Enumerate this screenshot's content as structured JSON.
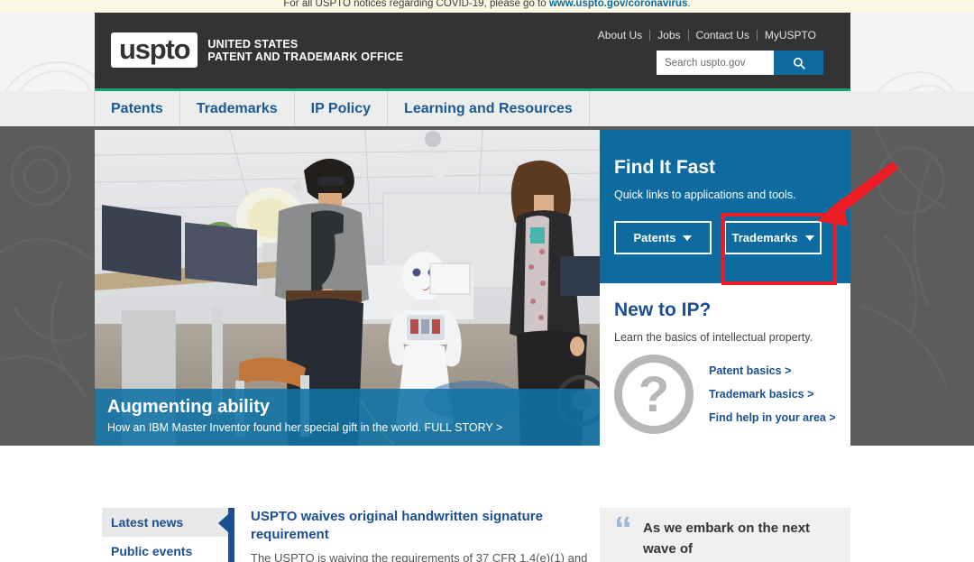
{
  "covid_banner": {
    "text": "For all USPTO notices regarding COVID-19, please go to ",
    "link": "www.uspto.gov/coronavirus",
    "suffix": "."
  },
  "header": {
    "logo_mark": "uspto",
    "logo_line1": "UNITED STATES",
    "logo_line2": "PATENT AND TRADEMARK OFFICE",
    "util_links": [
      "About Us",
      "Jobs",
      "Contact Us",
      "MyUSPTO"
    ],
    "search_placeholder": "Search uspto.gov",
    "search_value": "",
    "search_icon": "search-icon",
    "accent_green": "#1a9e6e",
    "background": "#333333"
  },
  "main_nav": {
    "items": [
      "Patents",
      "Trademarks",
      "IP Policy",
      "Learning and Resources"
    ],
    "link_color": "#1b5a96",
    "background": "#eceded"
  },
  "hero": {
    "title": "Augmenting ability",
    "subtitle": "How an IBM Master Inventor found her special gift in the world. FULL STORY >",
    "caption_color": "#1073a6"
  },
  "find_it_fast": {
    "title": "Find It Fast",
    "subtitle": "Quick links to applications and tools.",
    "buttons": [
      {
        "label": "Patents",
        "icon": "chevron-down-icon"
      },
      {
        "label": "Trademarks",
        "icon": "chevron-down-icon"
      }
    ],
    "background": "#0d6ba0"
  },
  "new_to_ip": {
    "title": "New to IP?",
    "subtitle": "Learn the basics of intellectual property.",
    "icon": "question-mark-icon",
    "icon_glyph": "?",
    "links": [
      "Patent basics >",
      "Trademark basics >",
      "Find help in your area >"
    ],
    "link_color": "#1b4f91"
  },
  "news": {
    "tabs": [
      {
        "label": "Latest news",
        "active": true
      },
      {
        "label": "Public events",
        "active": false
      }
    ],
    "headline": "USPTO waives original handwritten signature requirement",
    "body": "The USPTO is waiving the requirements of 37 CFR 1.4(e)(1) and"
  },
  "quote": {
    "mark": "“",
    "text": "As we embark on the next wave of",
    "mark_color": "#9fb8d4"
  },
  "annotations": {
    "highlight_color": "#ee1c25",
    "arrow_label": "red-arrow-pointing-to-trademarks-button",
    "box_label": "red-highlight-box-around-trademarks-button"
  }
}
